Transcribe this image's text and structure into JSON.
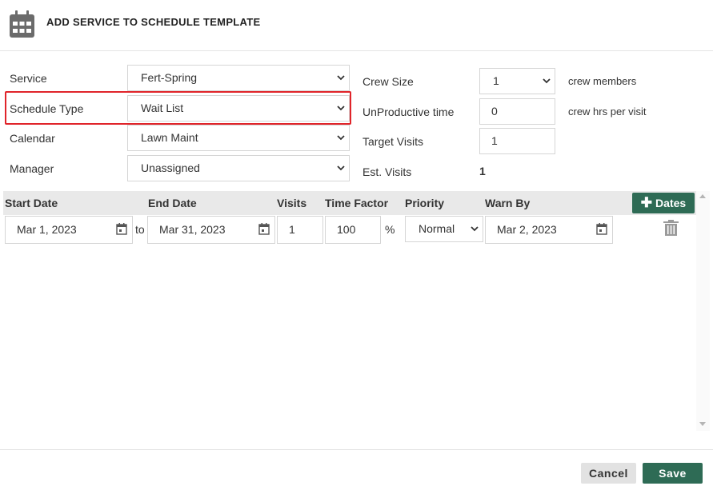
{
  "header": {
    "title": "ADD SERVICE TO SCHEDULE TEMPLATE",
    "icon": "calendar-icon"
  },
  "form": {
    "service": {
      "label": "Service",
      "value": "Fert-Spring"
    },
    "schedule_type": {
      "label": "Schedule Type",
      "value": "Wait List"
    },
    "calendar": {
      "label": "Calendar",
      "value": "Lawn Maint"
    },
    "manager": {
      "label": "Manager",
      "value": "Unassigned"
    },
    "crew_size": {
      "label": "Crew Size",
      "value": "1",
      "suffix": "crew members"
    },
    "unproductive_time": {
      "label": "UnProductive time",
      "value": "0",
      "suffix": "crew hrs per visit"
    },
    "target_visits": {
      "label": "Target Visits",
      "value": "1"
    },
    "est_visits": {
      "label": "Est. Visits",
      "value": "1"
    }
  },
  "grid": {
    "columns": [
      "Start Date",
      "End Date",
      "Visits",
      "Time Factor",
      "Priority",
      "Warn By"
    ],
    "add_dates_label": "Dates",
    "rows": [
      {
        "start_date": "Mar 1, 2023",
        "to_label": "to",
        "end_date": "Mar 31, 2023",
        "visits": "1",
        "time_factor": "100",
        "percent": "%",
        "priority": "Normal",
        "warn_by": "Mar 2, 2023"
      }
    ]
  },
  "footer": {
    "cancel_label": "Cancel",
    "save_label": "Save"
  },
  "colors": {
    "accent": "#2e6b55",
    "highlight": "#e0242a"
  }
}
